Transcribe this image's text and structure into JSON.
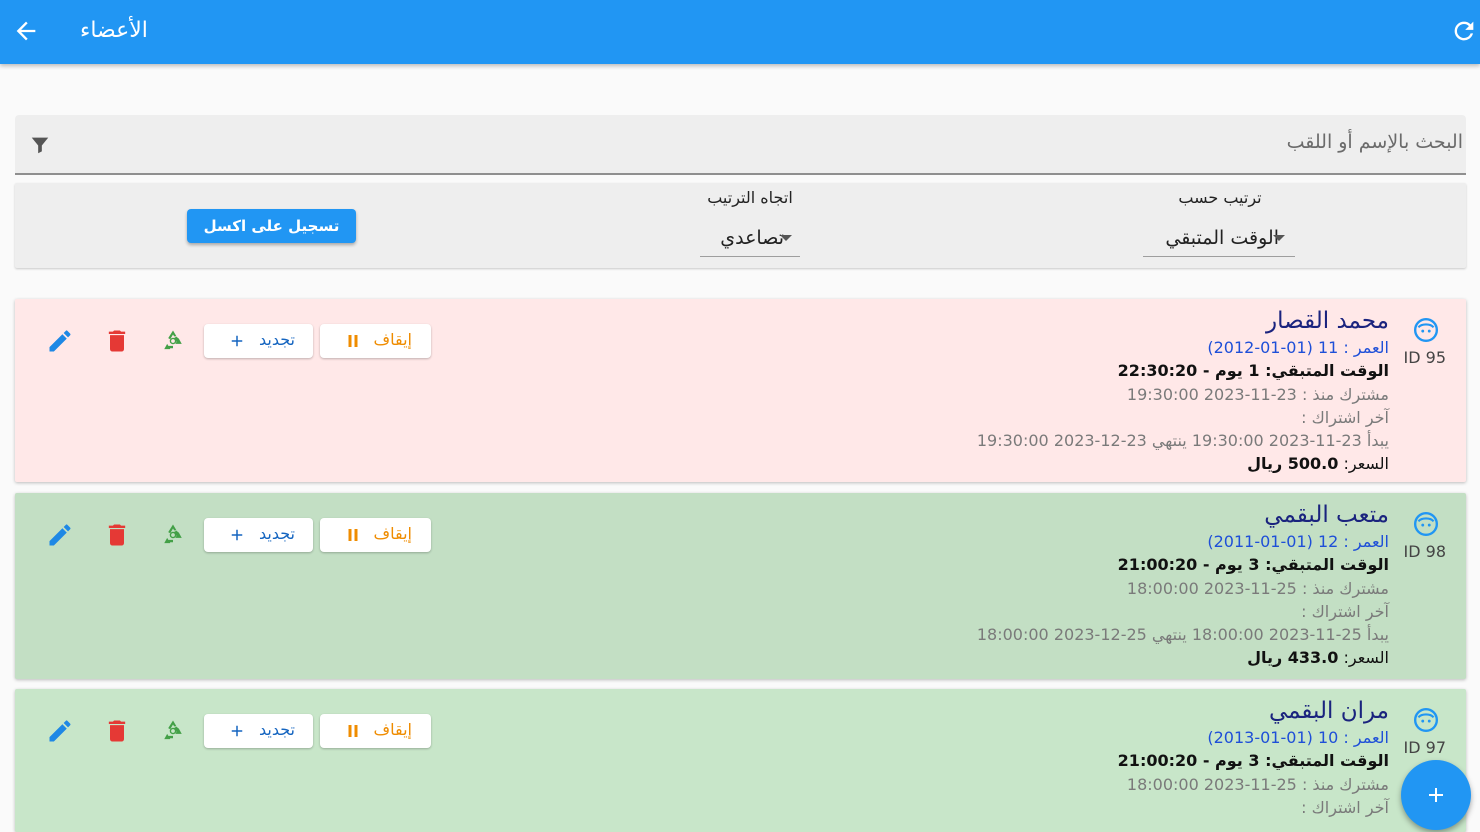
{
  "appbar": {
    "title": "الأعضاء"
  },
  "search": {
    "placeholder": "البحث بالإسم أو اللقب"
  },
  "sort": {
    "by_label": "ترتيب حسب",
    "by_value": "الوقت المتبقي",
    "direction_label": "اتجاه الترتيب",
    "direction_value": "تصاعدي",
    "excel_button": "تسجيل على اكسل"
  },
  "labels": {
    "pause": "إيقاف",
    "renew": "تجديد"
  },
  "colors": {
    "primary": "#2196f3",
    "card_expiring": "#ffe8e8",
    "card_active": "#c3dfc4",
    "pause": "#ef8c00",
    "delete": "#e53935",
    "recycle": "#43a047",
    "edit": "#1e88e5"
  },
  "members": [
    {
      "id_text": "ID 95",
      "name": "محمد القصار",
      "age": "العمر : 11 (01-01-2012)",
      "remaining": "الوقت المتبقي: 1 يوم - 22:30:20",
      "since": "مشترك منذ : 23-11-2023 19:30:00",
      "last": "آخر اشتراك :",
      "period": "يبدأ 23-11-2023 19:30:00 ينتهي 23-12-2023 19:30:00",
      "price_label": "السعر:",
      "price_value": "500.0 ريال"
    },
    {
      "id_text": "ID 98",
      "name": "متعب البقمي",
      "age": "العمر : 12 (01-01-2011)",
      "remaining": "الوقت المتبقي: 3 يوم - 21:00:20",
      "since": "مشترك منذ : 25-11-2023 18:00:00",
      "last": "آخر اشتراك :",
      "period": "يبدأ 25-11-2023 18:00:00 ينتهي 25-12-2023 18:00:00",
      "price_label": "السعر:",
      "price_value": "433.0 ريال"
    },
    {
      "id_text": "ID 97",
      "name": "مران البقمي",
      "age": "العمر : 10 (01-01-2013)",
      "remaining": "الوقت المتبقي: 3 يوم - 21:00:20",
      "since": "مشترك منذ : 25-11-2023 18:00:00",
      "last": "آخر اشتراك :"
    }
  ]
}
